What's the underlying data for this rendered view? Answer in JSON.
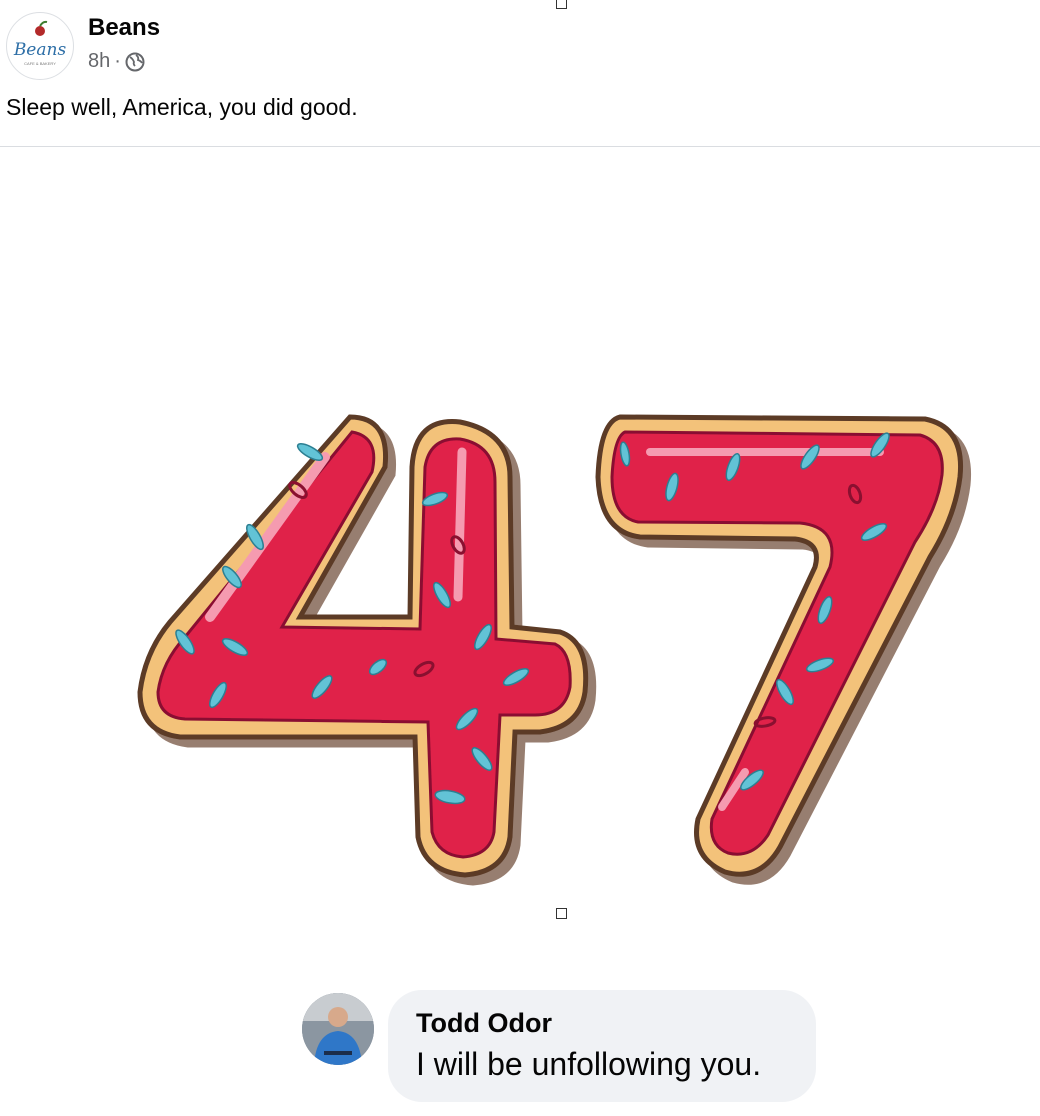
{
  "post": {
    "page_name": "Beans",
    "avatar_logo_text": "Beans",
    "avatar_logo_subtext": "CAFE & BAKERY",
    "time": "8h",
    "separator": "·",
    "audience_icon": "globe-icon",
    "text": "Sleep well, America, you did good.",
    "image_text": "47",
    "image_description_icon": "donut-number-illustration"
  },
  "comment": {
    "author": "Todd Odor",
    "text": "I will be unfollowing you."
  },
  "colors": {
    "name_text": "#050505",
    "secondary_text": "#65676b",
    "bubble_bg": "#f0f2f5",
    "icing": "#e0224a",
    "dough": "#f3c27a",
    "sprinkle": "#62c3d6"
  }
}
